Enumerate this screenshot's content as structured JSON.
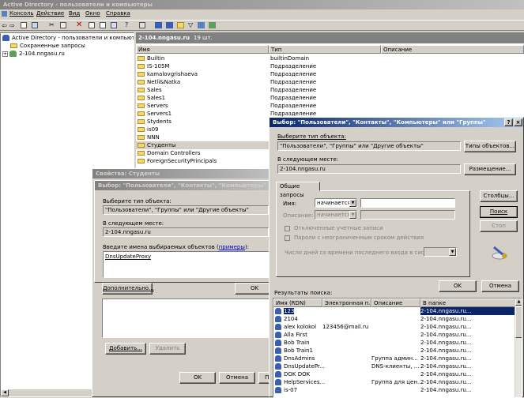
{
  "app": {
    "title": "Active Directory - пользователи и компьютеры"
  },
  "menu": [
    "Консоль",
    "Действие",
    "Вид",
    "Окно",
    "Справка"
  ],
  "tree": {
    "root": "Active Directory - пользователи и компьютеры [2-",
    "saved": "Сохраненные запросы",
    "domain": "2-104.nngasu.ru"
  },
  "list": {
    "title": "2-104.nngasu.ru",
    "count": "19 шт.",
    "headers": [
      "Имя",
      "Тип",
      "Описание"
    ],
    "items": [
      [
        "Builtin",
        "builtinDomain"
      ],
      [
        "IS-105M",
        "Подразделение"
      ],
      [
        "kamalovgrishaeva",
        "Подразделение"
      ],
      [
        "Netli&Natka",
        "Подразделение"
      ],
      [
        "Sales",
        "Подразделение"
      ],
      [
        "Sales1",
        "Подразделение"
      ],
      [
        "Servers",
        "Подразделение"
      ],
      [
        "Servers1",
        "Подразделение"
      ],
      [
        "Stydents",
        "Подразделение"
      ],
      [
        "is09",
        "Подразделение"
      ],
      [
        "NNN",
        "Подразделение"
      ],
      [
        "Студенты",
        "Подразделение"
      ],
      [
        "Domain Controllers",
        ""
      ],
      [
        "ForeignSecurityPrincipals",
        ""
      ]
    ]
  },
  "props": {
    "title": "Свойства: Студенты",
    "inner_title": "Выбор: \"Пользователи\", \"Контакты\", \"Компьютеры\" или \"Груп",
    "type_label": "Выберите тип объекта:",
    "type_value": "\"Пользователи\", \"Группы\" или \"Другие объекты\"",
    "loc_label": "В следующем месте:",
    "loc_value": "2-104.nngasu.ru",
    "names_label": "Введите имена выбираемых объектов",
    "examples": "примеры",
    "names_value": "DnsUpdateProxy",
    "advanced": "Дополнительно...",
    "ok": "OK",
    "add": "Добавить...",
    "remove": "Удалить",
    "ok2": "OK",
    "cancel": "Отмена",
    "apply": "Приме"
  },
  "select": {
    "title": "Выбор: \"Пользователи\", \"Контакты\", \"Компьютеры\" или \"Группы\"",
    "type_label": "Выберите тип объекта:",
    "type_value": "\"Пользователи\", \"Группы\" или \"Другие объекты\"",
    "types_btn": "Типы объектов...",
    "loc_label": "В следующем месте:",
    "loc_value": "2-104.nngasu.ru",
    "loc_btn": "Размещение...",
    "tab": "Общие запросы",
    "name_label": "Имя:",
    "name_op": "начинается",
    "desc_label": "Описание:",
    "desc_op": "начинается",
    "cb1": "Отключенные учетные записи",
    "cb2": "Пароли с неограниченным сроком действия",
    "days_label": "Число дней со времени последнего входа в систему:",
    "columns_btn": "Столбцы...",
    "find_btn": "Поиск",
    "stop_btn": "Стоп",
    "ok": "OK",
    "cancel": "Отмена",
    "results_label": "Результаты поиска:",
    "headers": [
      "Имя (RDN)",
      "Электронная п...",
      "Описание",
      "В папке"
    ],
    "rows": [
      [
        "123",
        "",
        "",
        "2-104.nngasu.ru..."
      ],
      [
        "2104",
        "",
        "",
        "2-104.nngasu.ru..."
      ],
      [
        "alex kolokol",
        "123456@mail.ru",
        "",
        "2-104.nngasu.ru..."
      ],
      [
        "Alla First",
        "",
        "",
        "2-104.nngasu.ru..."
      ],
      [
        "Bob Train",
        "",
        "",
        "2-104.nngasu.ru..."
      ],
      [
        "Bob Train1",
        "",
        "",
        "2-104.nngasu.ru..."
      ],
      [
        "DnsAdmins",
        "",
        "Группа админ...",
        "2-104.nngasu.ru..."
      ],
      [
        "DnsUpdatePr...",
        "",
        "DNS-клиенты, ...",
        "2-104.nngasu.ru..."
      ],
      [
        "DOK DOK",
        "",
        "",
        "2-104.nngasu.ru..."
      ],
      [
        "HelpServices...",
        "",
        "Группа для цен...",
        "2-104.nngasu.ru..."
      ],
      [
        "is-07",
        "",
        "",
        "2-104.nngasu.ru..."
      ]
    ]
  }
}
